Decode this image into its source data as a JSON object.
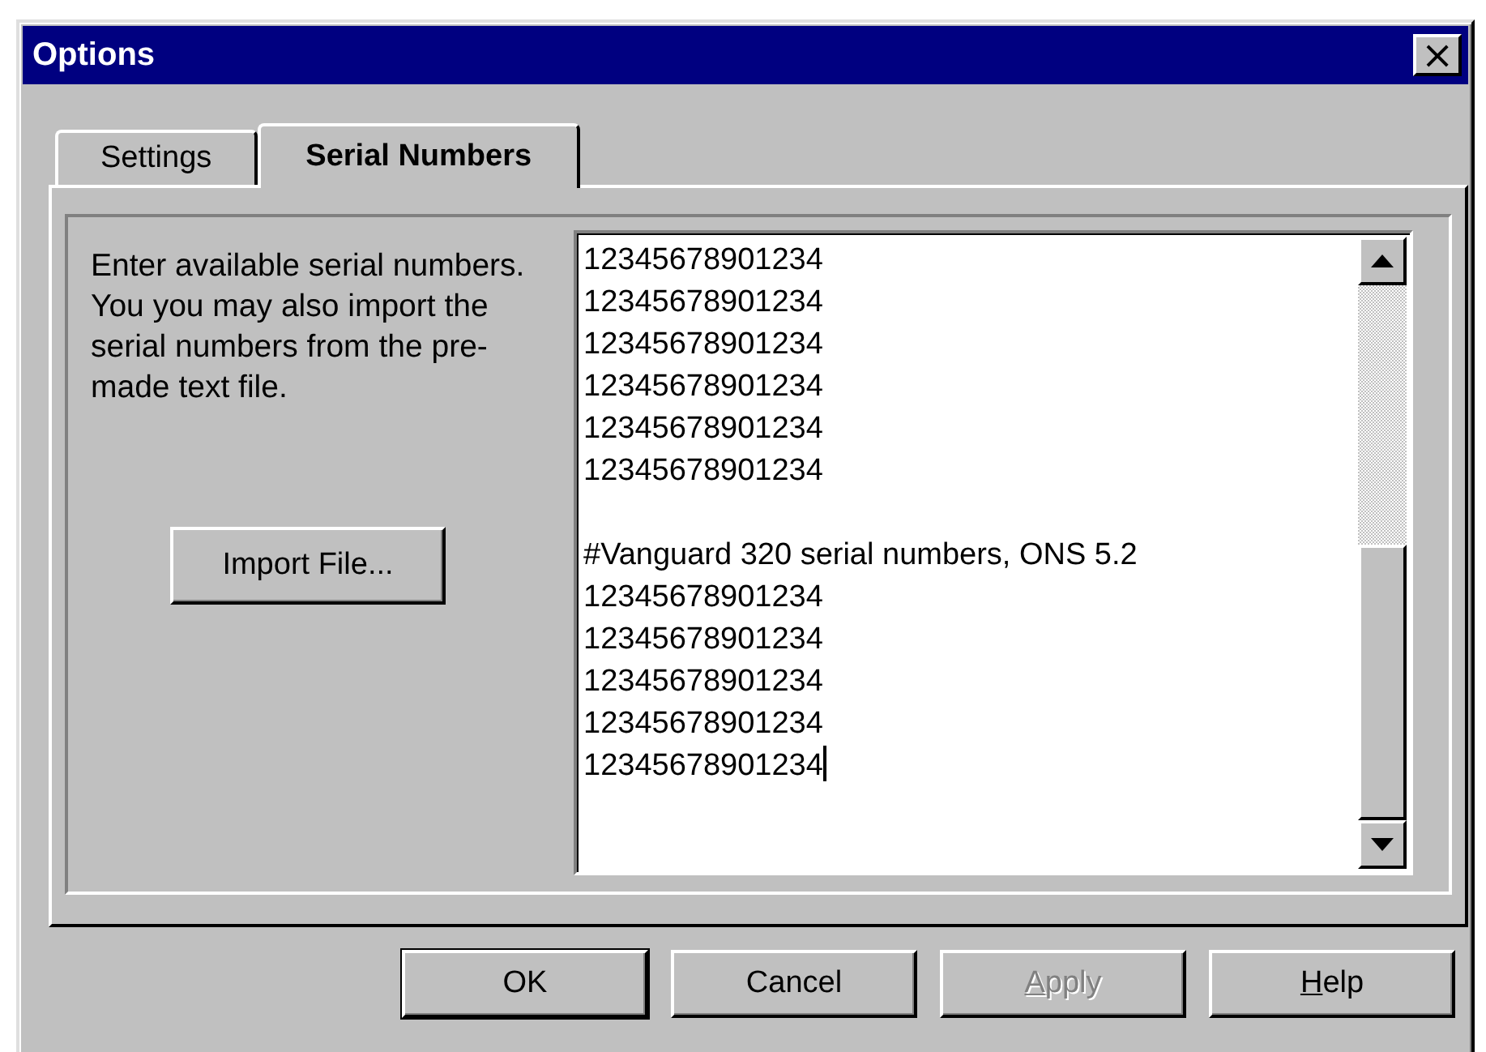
{
  "window": {
    "title": "Options",
    "close_glyph": "×"
  },
  "tabs": [
    {
      "label": "Settings",
      "selected": false
    },
    {
      "label": "Serial Numbers",
      "selected": true
    }
  ],
  "description": "Enter available serial numbers. You you may also import the serial numbers from the pre-made text file.",
  "import_button": "Import File...",
  "serial_text": {
    "blocks": [
      [
        "12345678901234",
        "12345678901234",
        "12345678901234",
        "12345678901234",
        "12345678901234",
        "12345678901234"
      ],
      [
        "#Vanguard 320 serial numbers, ONS 5.2",
        "12345678901234",
        "12345678901234",
        "12345678901234",
        "12345678901234",
        "12345678901234"
      ]
    ]
  },
  "buttons": [
    {
      "label": "OK",
      "default": true,
      "disabled": false
    },
    {
      "label": "Cancel",
      "default": false,
      "disabled": false
    },
    {
      "key": "A",
      "label": "pply",
      "default": false,
      "disabled": true
    },
    {
      "key": "H",
      "label": "elp",
      "default": false,
      "disabled": false
    }
  ]
}
